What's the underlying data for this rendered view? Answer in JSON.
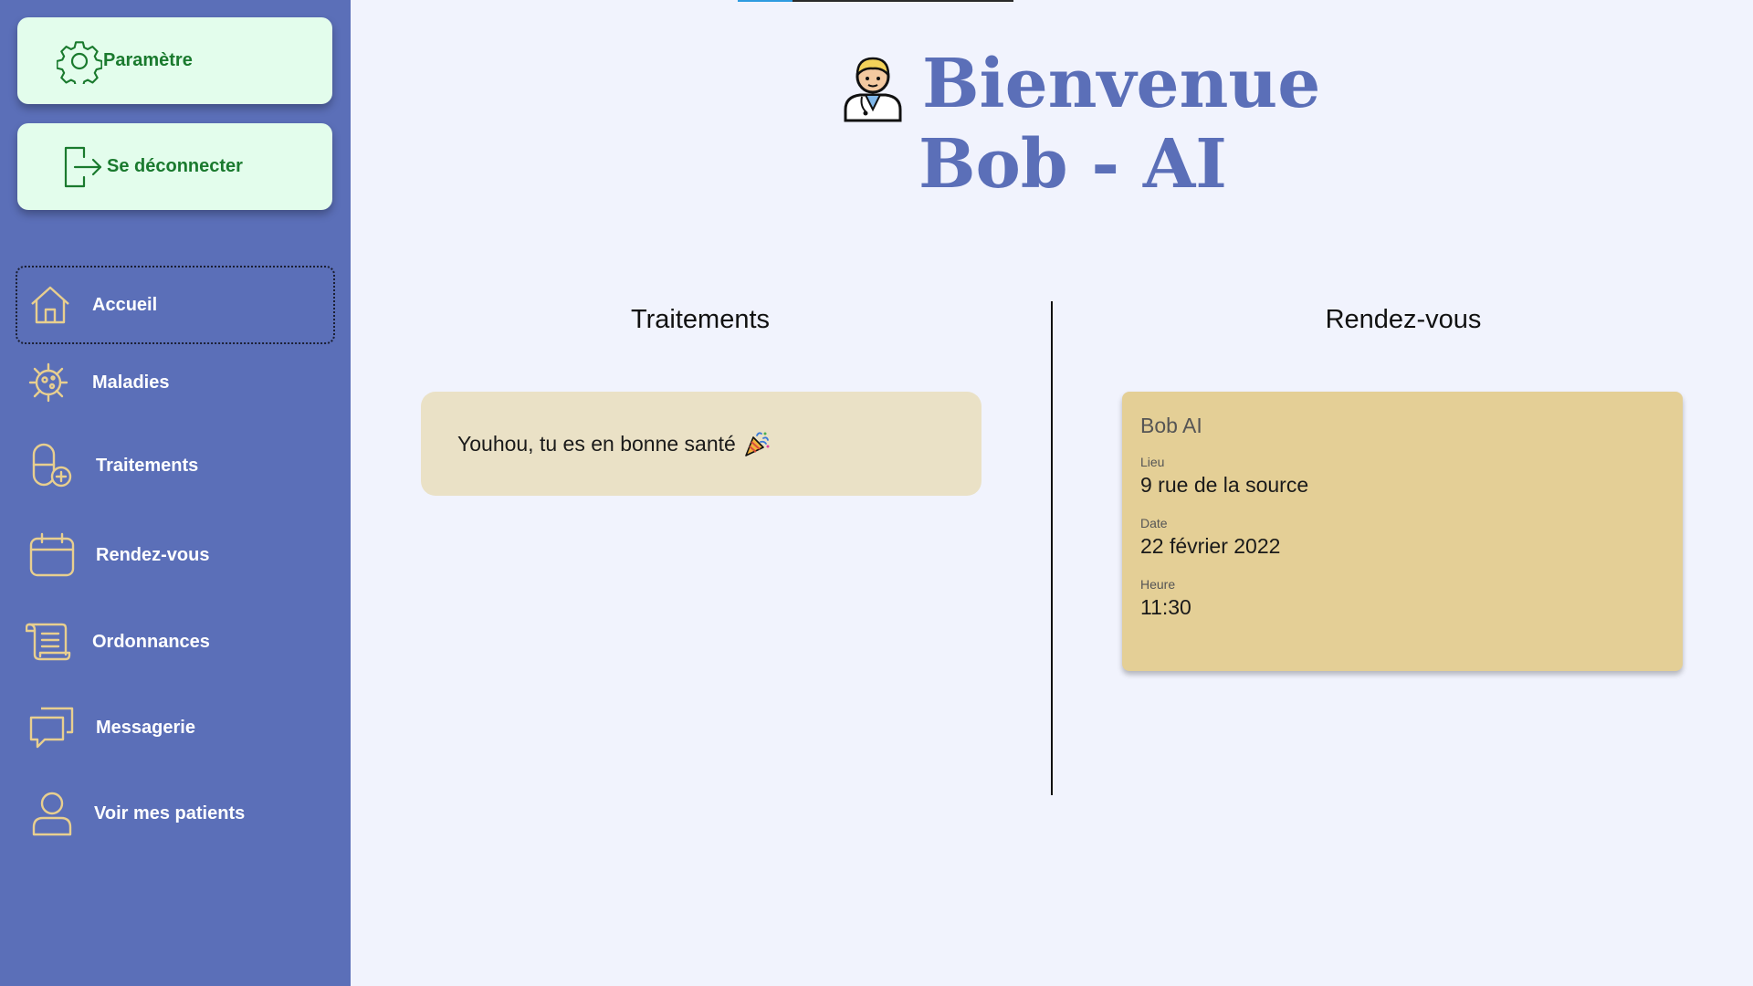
{
  "sidebar": {
    "settings_label": "Paramètre",
    "logout_label": "Se déconnecter",
    "items": [
      {
        "label": "Accueil",
        "icon": "home-icon",
        "active": true
      },
      {
        "label": "Maladies",
        "icon": "virus-icon"
      },
      {
        "label": "Traitements",
        "icon": "pill-add-icon"
      },
      {
        "label": "Rendez-vous",
        "icon": "calendar-icon"
      },
      {
        "label": "Ordonnances",
        "icon": "scroll-icon"
      },
      {
        "label": "Messagerie",
        "icon": "chat-icon"
      },
      {
        "label": "Voir mes patients",
        "icon": "user-icon"
      }
    ]
  },
  "header": {
    "line1": "Bienvenue",
    "line2": "Bob - AI",
    "avatar_icon": "doctor-emoji"
  },
  "traitements": {
    "title": "Traitements",
    "message": "Youhou, tu es en bonne santé",
    "emoji_icon": "party-popper-icon"
  },
  "rendezvous": {
    "title": "Rendez-vous",
    "card": {
      "name": "Bob AI",
      "lieu_label": "Lieu",
      "lieu": "9 rue de la source",
      "date_label": "Date",
      "date": "22 février 2022",
      "heure_label": "Heure",
      "heure": "11:30"
    }
  },
  "colors": {
    "sidebar_bg": "#5b6fb8",
    "top_button_bg": "#e3fdec",
    "top_button_text": "#1a7a2e",
    "icon_accent": "#e8cf8f",
    "page_bg": "#f1f3fd",
    "health_card_bg": "#eae1c6",
    "rdv_card_bg": "#e4cf96"
  }
}
